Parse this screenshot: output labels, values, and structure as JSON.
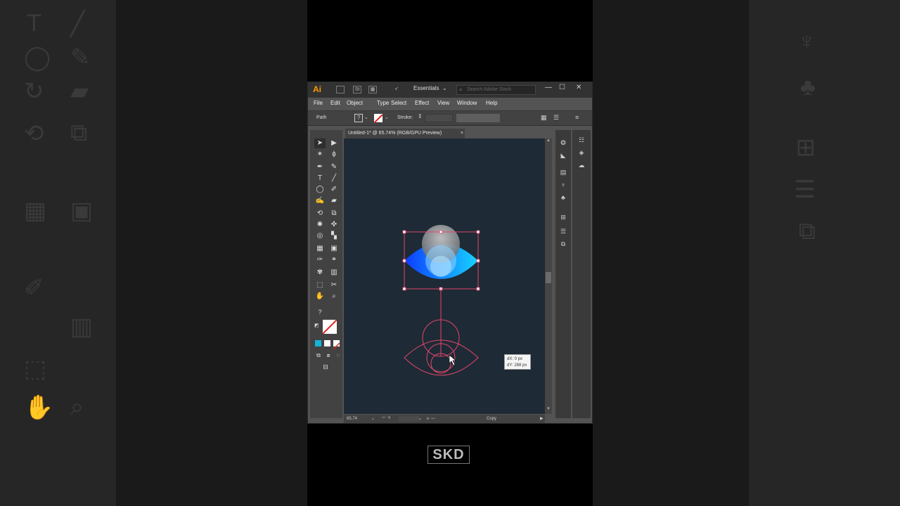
{
  "app": {
    "logo": "Ai",
    "workspace": "Essentials",
    "search_placeholder": "Search Adobe Stock",
    "menu": [
      "File",
      "Edit",
      "Object",
      "Type",
      "Select",
      "Effect",
      "View",
      "Window",
      "Help"
    ],
    "control_bar": {
      "selection_type": "Path",
      "stroke_label": "Stroke:"
    },
    "document_tab": {
      "title": "Untitled-1* @ 65.74% (RGB/GPU Preview)",
      "close": "×"
    },
    "fill_stroke_default": "?",
    "status": {
      "zoom": "65.74",
      "status_text": "Copy"
    },
    "tooltip": {
      "dx": "dX: 0 px",
      "dy": "dY: 288 px"
    },
    "colors": {
      "accent_logo": "#ff9a00",
      "canvas": "#1e2a35",
      "selection": "#e0476b",
      "gradient_start": "#0d5cff",
      "gradient_end": "#17c6ff"
    }
  },
  "watermark": "SKD",
  "icons": {
    "tools": [
      "selection-tool",
      "direct-selection-tool",
      "magic-wand-tool",
      "lasso-tool",
      "pen-tool",
      "curvature-tool",
      "type-tool",
      "line-tool",
      "ellipse-tool",
      "paintbrush-tool",
      "shaper-tool",
      "eraser-tool",
      "rotate-tool",
      "scale-tool",
      "warp-tool",
      "free-transform-tool",
      "shape-builder-tool",
      "perspective-tool",
      "mesh-tool",
      "gradient-tool",
      "eyedropper-tool",
      "blend-tool",
      "symbol-sprayer-tool",
      "graph-tool",
      "artboard-tool",
      "slice-tool",
      "hand-tool",
      "zoom-tool"
    ]
  }
}
